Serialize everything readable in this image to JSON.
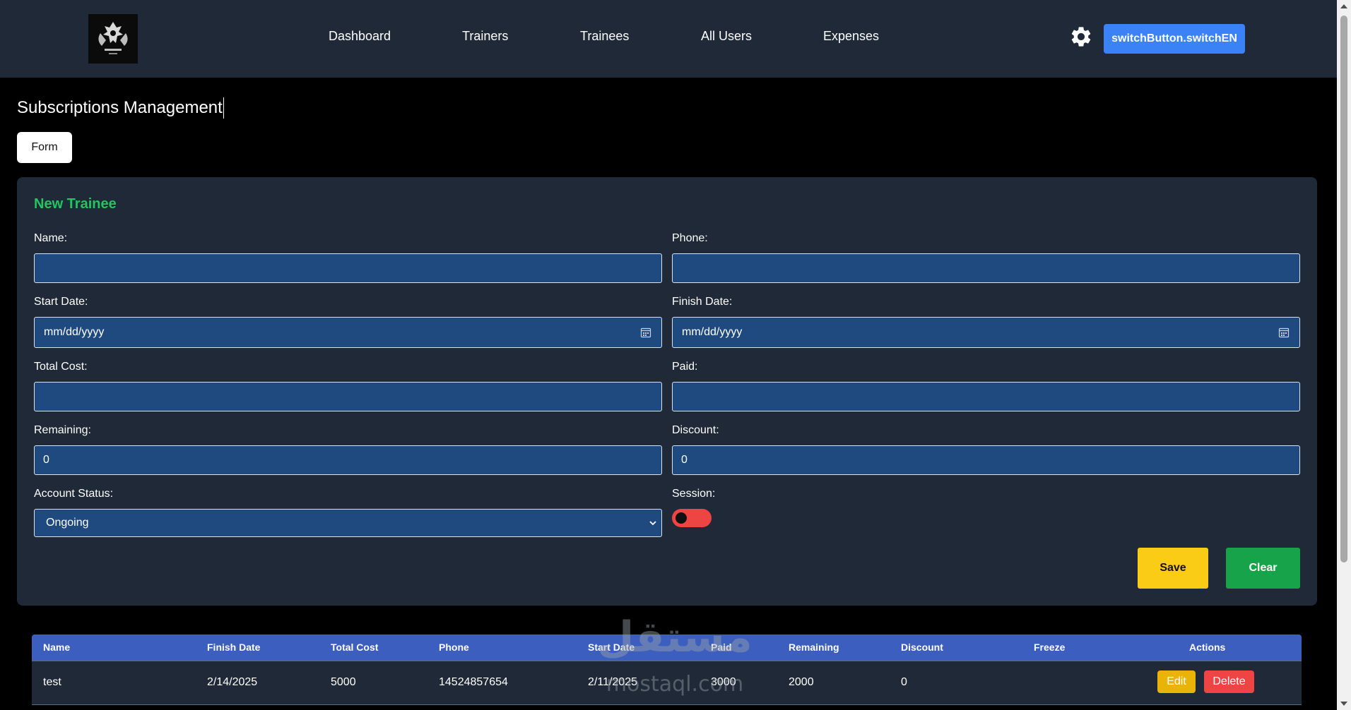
{
  "colors": {
    "background": "#000000",
    "navbar": "#1f2937",
    "card": "#1f2937",
    "input": "#1e4a80",
    "accent_blue": "#3b82f6",
    "title_green": "#22c55e",
    "save_yellow": "#facc15",
    "clear_green": "#16a34a",
    "edit_yellow": "#eab308",
    "delete_red": "#ef4444",
    "table_header": "#3c5fbf"
  },
  "nav": {
    "logo_icon": "gym-crest-logo",
    "links": [
      "Dashboard",
      "Trainers",
      "Trainees",
      "All Users",
      "Expenses"
    ],
    "settings_icon": "gear-icon",
    "switch_label": "switchButton.switchEN"
  },
  "page": {
    "title": "Subscriptions Management",
    "tab_label": "Form"
  },
  "form": {
    "title": "New Trainee",
    "name": {
      "label": "Name:",
      "value": ""
    },
    "phone": {
      "label": "Phone:",
      "value": ""
    },
    "start_date": {
      "label": "Start Date:",
      "placeholder": "mm/dd/yyyy"
    },
    "finish_date": {
      "label": "Finish Date:",
      "placeholder": "mm/dd/yyyy"
    },
    "total_cost": {
      "label": "Total Cost:",
      "value": ""
    },
    "paid": {
      "label": "Paid:",
      "value": ""
    },
    "remaining": {
      "label": "Remaining:",
      "value": "0"
    },
    "discount": {
      "label": "Discount:",
      "value": "0"
    },
    "account_status": {
      "label": "Account Status:",
      "selected": "Ongoing"
    },
    "session": {
      "label": "Session:",
      "on": false
    },
    "save_label": "Save",
    "clear_label": "Clear"
  },
  "table": {
    "headers": [
      "Name",
      "Finish Date",
      "Total Cost",
      "Phone",
      "Start Date",
      "Paid",
      "Remaining",
      "Discount",
      "Freeze",
      "Actions"
    ],
    "rows": [
      {
        "name": "test",
        "finish_date": "2/14/2025",
        "total_cost": "5000",
        "phone": "14524857654",
        "start_date": "2/11/2025",
        "paid": "3000",
        "remaining": "2000",
        "discount": "0",
        "freeze": "",
        "edit_label": "Edit",
        "delete_label": "Delete"
      }
    ]
  },
  "watermark": {
    "arabic": "مستقل",
    "latin": "mostaql.com"
  }
}
